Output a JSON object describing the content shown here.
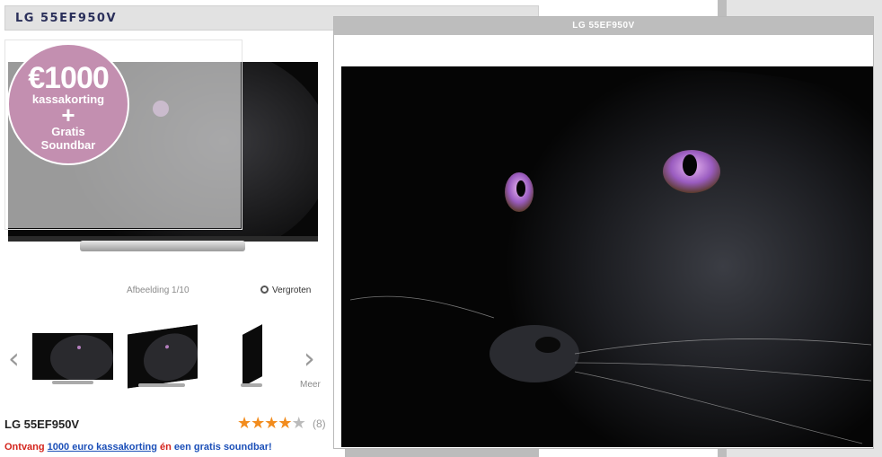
{
  "product": {
    "title": "LG 55EF950V",
    "name": "LG 55EF950V",
    "review_count": "(8)",
    "rating": 4.5
  },
  "badge": {
    "amount": "€1000",
    "line1": "kassakorting",
    "plus": "+",
    "line2": "Gratis",
    "line3": "Soundbar"
  },
  "gallery": {
    "counter": "Afbeelding 1/10",
    "zoom_label": "Vergroten",
    "more_label": "Meer"
  },
  "promo": {
    "part1": "Ontvang ",
    "link": "1000 euro kassakorting",
    "part2": " én ",
    "part3": "een gratis soundbar!"
  },
  "popup": {
    "title": "LG 55EF950V"
  },
  "colors": {
    "badge": "#c38fb0",
    "star": "#f28c1e",
    "promo_red": "#d4241c",
    "promo_blue": "#1b4fb8",
    "title_text": "#2a2f5a"
  },
  "icons": [
    "magnifier-icon",
    "chevron-left-icon",
    "chevron-right-icon",
    "star-icon"
  ]
}
